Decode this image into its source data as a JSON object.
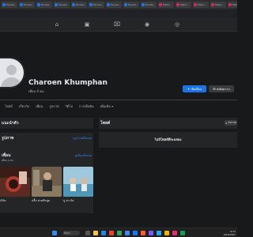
{
  "browser": {
    "tabs": [
      {
        "label": "Facebo",
        "variant": "blue"
      },
      {
        "label": "Facebo",
        "variant": "blue"
      },
      {
        "label": "Facebo",
        "variant": "blue"
      },
      {
        "label": "Facebo",
        "variant": "blue"
      },
      {
        "label": "Facebo",
        "variant": "blue"
      },
      {
        "label": "Facebo",
        "variant": "blue"
      },
      {
        "label": "Facebo",
        "variant": "blue"
      },
      {
        "label": "Facebo",
        "variant": "blue"
      },
      {
        "label": "Facebo",
        "variant": "blue"
      },
      {
        "label": "Meta l",
        "variant": "red"
      },
      {
        "label": "Meta l",
        "variant": "red"
      },
      {
        "label": "Meta l",
        "variant": "red"
      },
      {
        "label": "Meta l",
        "variant": "red"
      },
      {
        "label": "Meta l",
        "variant": "red"
      }
    ]
  },
  "nav": {
    "icons": [
      "home-icon",
      "video-icon",
      "marketplace-icon",
      "groups-icon",
      "gaming-icon"
    ]
  },
  "profile": {
    "name": "Charoen Khumphan",
    "friends_count": "เพื่อน 4 คน",
    "add_friend_label": "เพิ่มเพื่อน",
    "message_label": "ส่งข้อความ"
  },
  "profile_tabs": [
    "โพสต์",
    "เกี่ยวกับ",
    "เพื่อน",
    "รูปภาพ",
    "วิดีโอ",
    "การเช็คอิน",
    "เพิ่มเติม ▾"
  ],
  "left": {
    "intro_title": "แนะนำตัว",
    "photos_title": "รูปภาพ",
    "photos_link": "ดูรูปภาพทั้งหมด",
    "friends_title": "เพื่อน",
    "friends_link": "ดูเพื่อนทั้งหมด",
    "friends_count": "เพื่อน 4 คน",
    "friends": [
      {
        "name": "เบิร์ด"
      },
      {
        "name": "ปลื้ม สายฟ้าพูด"
      },
      {
        "name": "ปู จ่าวรัส"
      }
    ]
  },
  "right": {
    "posts_title": "โพสต์",
    "filter_label": "ตัวกรอง",
    "no_posts": "ไม่มีโพสต์ที่จะแสดง"
  },
  "taskbar": {
    "search_placeholder": "ค้นหา",
    "time": "9:37",
    "date": "16/3/2567"
  },
  "colors": {
    "accent": "#2d88ff",
    "primary_button": "#1b74e4",
    "background": "#18191a",
    "card": "#242526"
  }
}
